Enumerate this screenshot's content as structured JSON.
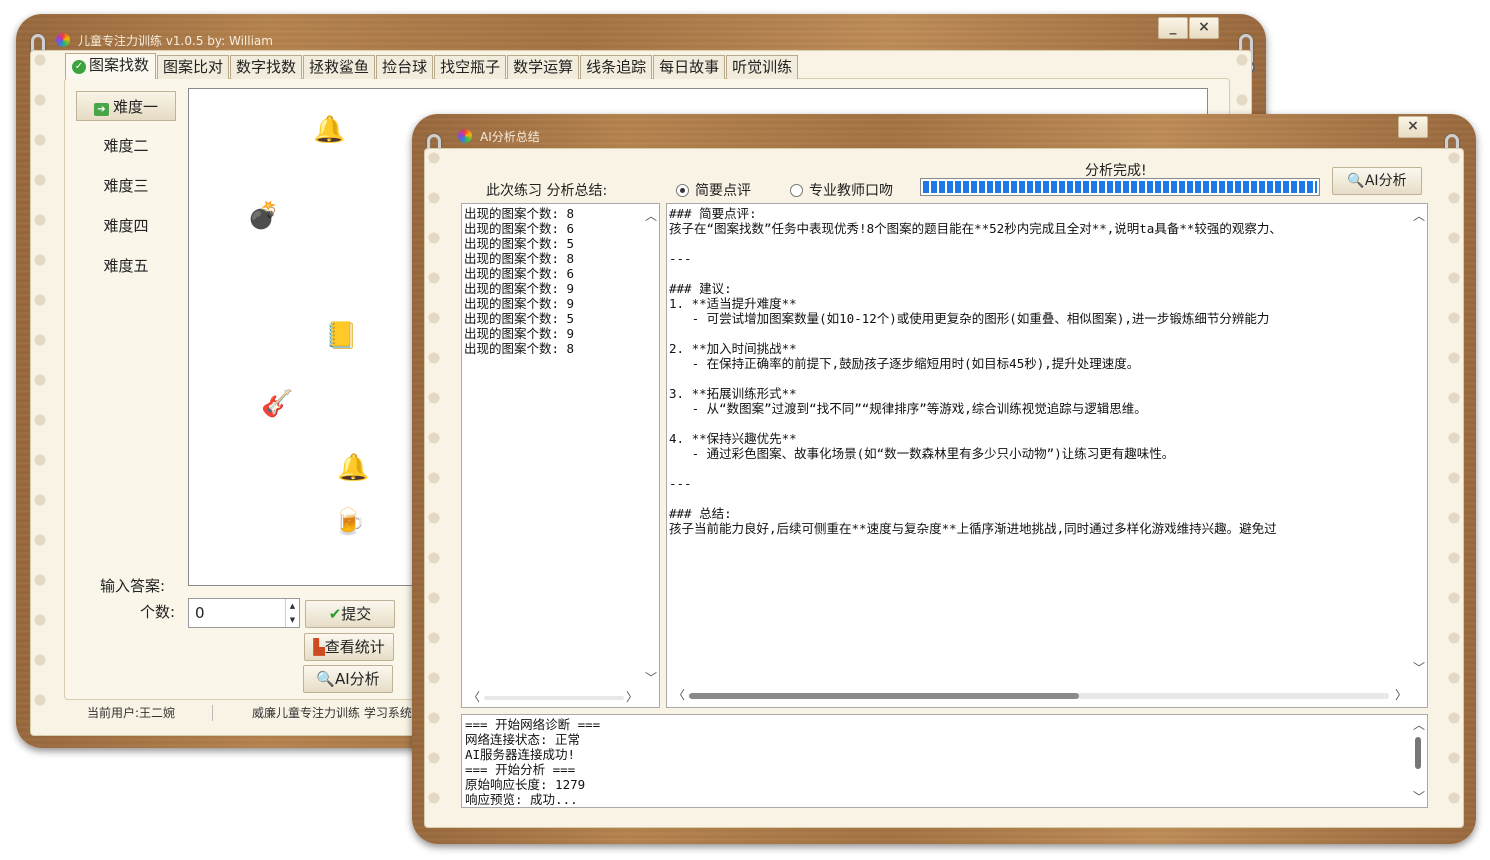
{
  "main": {
    "title": "儿童专注力训练 v1.0.5 by: William",
    "minimize": "_",
    "close": "×",
    "tabs": [
      "图案找数",
      "图案比对",
      "数字找数",
      "拯救鲨鱼",
      "捡台球",
      "找空瓶子",
      "数学运算",
      "线条追踪",
      "每日故事",
      "听觉训练"
    ],
    "levels": [
      "难度一",
      "难度二",
      "难度三",
      "难度四",
      "难度五"
    ],
    "items": [
      {
        "icon": "bell-icon",
        "glyph": "🔔"
      },
      {
        "icon": "bomb-icon",
        "glyph": "💣"
      },
      {
        "icon": "address-book-icon",
        "glyph": "📒"
      },
      {
        "icon": "guitar-icon",
        "glyph": "🎸"
      },
      {
        "icon": "bell-icon",
        "glyph": "🔔"
      },
      {
        "icon": "beer-icon",
        "glyph": "🍺"
      }
    ],
    "answer_label": "输入答案:",
    "count_label": "个数:",
    "count_value": "0",
    "submit": "提交",
    "stats": "查看统计",
    "ai": "AI分析",
    "status_user": "当前用户:王二婉",
    "status_app": "威廉儿童专注力训练 学习系统"
  },
  "ai": {
    "title": "AI分析总结",
    "close": "×",
    "summary_label": "此次练习 分析总结:",
    "mode_simple": "简要点评",
    "mode_teacher": "专业教师口吻",
    "selected_mode": "简要点评",
    "progress_text": "分析完成!",
    "progress": 1.0,
    "analyze_button": "AI分析",
    "records": [
      "出现的图案个数: 8",
      "出现的图案个数: 6",
      "出现的图案个数: 5",
      "出现的图案个数: 8",
      "出现的图案个数: 6",
      "出现的图案个数: 9",
      "出现的图案个数: 9",
      "出现的图案个数: 5",
      "出现的图案个数: 9",
      "出现的图案个数: 8"
    ],
    "analysis_text": "### 简要点评:\n孩子在“图案找数”任务中表现优秀!8个图案的题目能在**52秒内完成且全对**,说明ta具备**较强的观察力、\n\n---\n\n### 建议:\n1. **适当提升难度**\n   - 可尝试增加图案数量(如10-12个)或使用更复杂的图形(如重叠、相似图案),进一步锻炼细节分辨能力\n\n2. **加入时间挑战**\n   - 在保持正确率的前提下,鼓励孩子逐步缩短用时(如目标45秒),提升处理速度。\n\n3. **拓展训练形式**\n   - 从“数图案”过渡到“找不同”“规律排序”等游戏,综合训练视觉追踪与逻辑思维。\n\n4. **保持兴趣优先**\n   - 通过彩色图案、故事化场景(如“数一数森林里有多少只小动物”)让练习更有趣味性。\n\n---\n\n### 总结:\n孩子当前能力良好,后续可侧重在**速度与复杂度**上循序渐进地挑战,同时通过多样化游戏维持兴趣。避免过",
    "log_text": "=== 开始网络诊断 ===\n网络连接状态: 正常\nAI服务器连接成功!\n=== 开始分析 ===\n原始响应长度: 1279\n响应预览: 成功..."
  },
  "colors": {
    "progress": "#1e78e6",
    "wood": "#a67545",
    "paper": "#f8f3e4"
  }
}
